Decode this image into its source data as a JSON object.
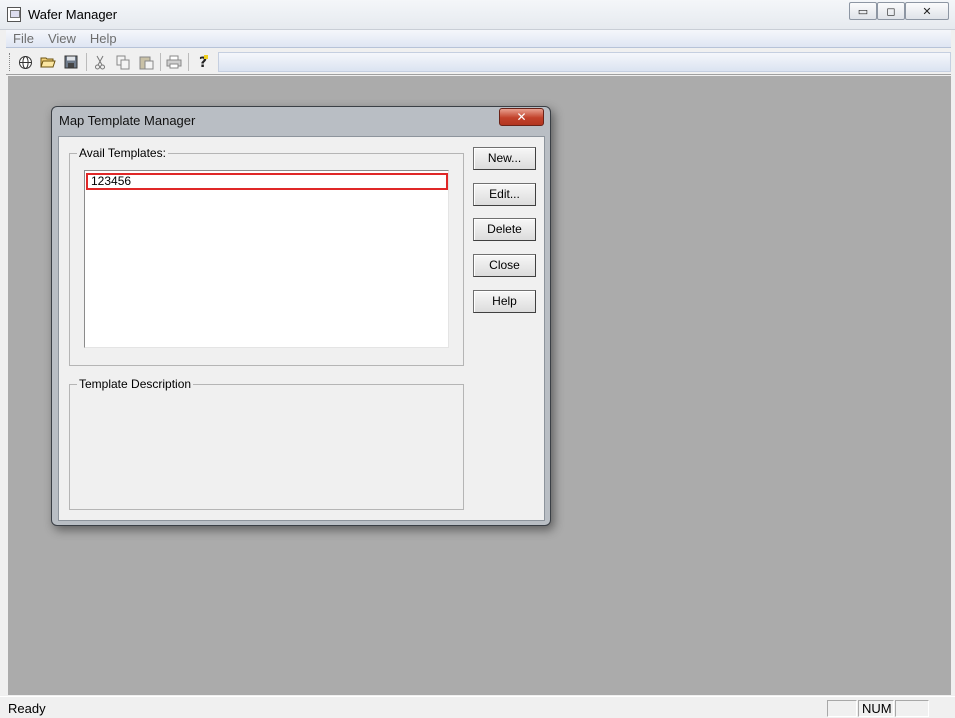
{
  "window": {
    "title": "Wafer Manager",
    "minimize_glyph": "▭",
    "maximize_glyph": "◻",
    "close_glyph": "✕"
  },
  "menu": [
    "File",
    "View",
    "Help"
  ],
  "toolbar": {
    "icons": [
      "globe-icon",
      "open-folder-icon",
      "save-icon",
      "cut-icon",
      "copy-icon",
      "paste-icon",
      "print-icon",
      "help-icon"
    ]
  },
  "dialog": {
    "title": "Map Template Manager",
    "close_glyph": "✕",
    "avail_label": "Avail Templates:",
    "templates": [
      "123456"
    ],
    "description_label": "Template Description",
    "buttons": {
      "new": "New...",
      "edit": "Edit...",
      "delete": "Delete",
      "close": "Close",
      "help": "Help"
    }
  },
  "status": {
    "text": "Ready",
    "num": "NUM"
  },
  "colors": {
    "client_bg": "#ababab",
    "selection_outline": "#e02828"
  }
}
